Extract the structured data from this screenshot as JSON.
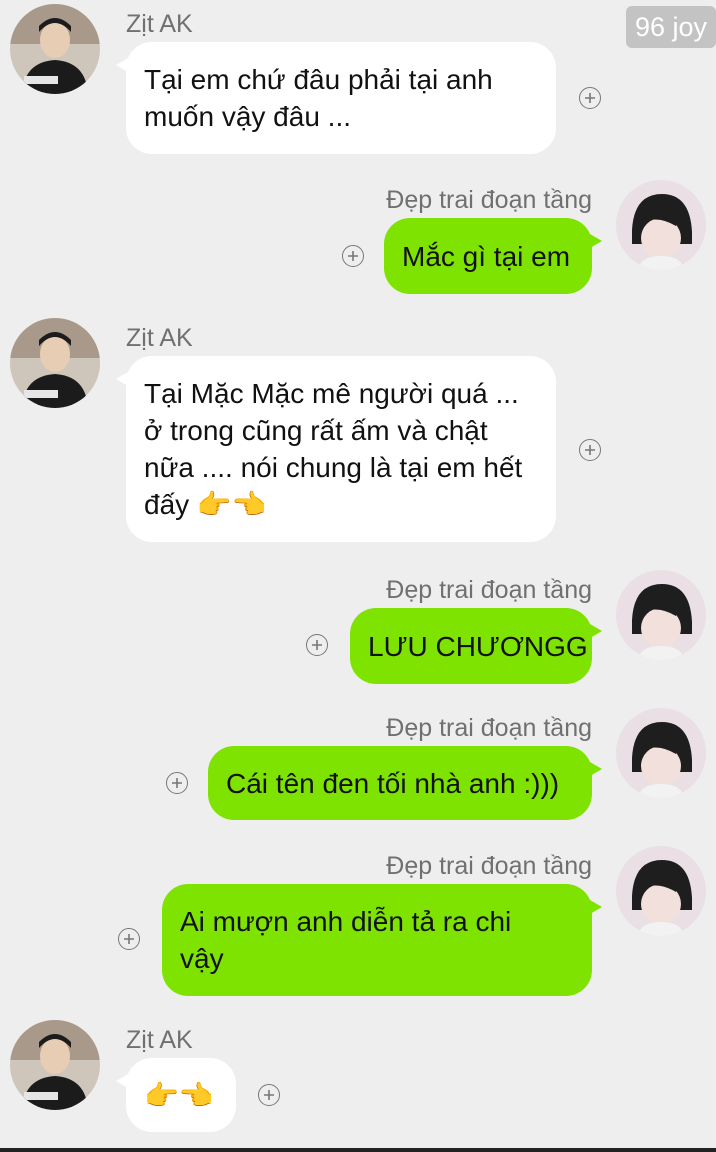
{
  "watermark": "96 joy",
  "contacts": {
    "left_name": "Zịt AK",
    "right_name": "Đẹp trai đoạn tầng"
  },
  "messages": [
    {
      "side": "in",
      "lines": [
        "Tại em chứ đâu phải tại anh",
        "muốn vậy đâu ..."
      ]
    },
    {
      "side": "out",
      "lines": [
        "Mắc gì tại em"
      ]
    },
    {
      "side": "in",
      "lines": [
        "Tại Mặc Mặc mê người quá ...",
        "ở trong cũng rất ấm và chật",
        "nữa .... nói chung là tại em hết",
        "đấy 👉👈"
      ]
    },
    {
      "side": "out",
      "lines": [
        "LƯU CHƯƠNGG"
      ]
    },
    {
      "side": "out",
      "lines": [
        "Cái tên đen tối nhà anh :)))"
      ]
    },
    {
      "side": "out",
      "lines": [
        "Ai mượn anh diễn tả ra chi",
        "vậy"
      ]
    },
    {
      "side": "in",
      "lines": [
        "👉👈"
      ]
    }
  ],
  "icons": {
    "react": "add-reaction-icon",
    "avatar_left": "profile-photo-man-jacket",
    "avatar_right": "profile-photo-boy-headphones"
  },
  "colors": {
    "background": "#eeeeee",
    "incoming_bubble": "#ffffff",
    "outgoing_bubble": "#7ee300"
  }
}
